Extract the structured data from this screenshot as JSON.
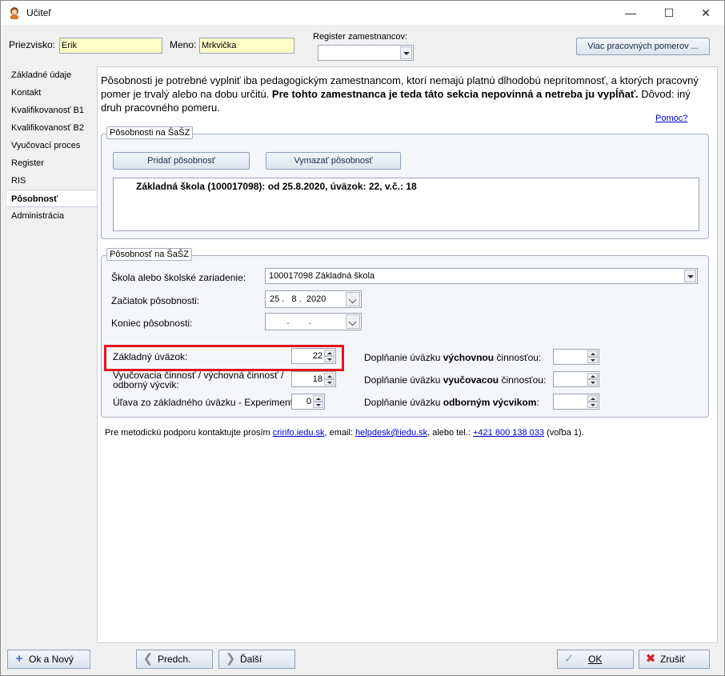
{
  "window": {
    "title": "Učiteľ"
  },
  "header": {
    "surname_label": "Priezvisko:",
    "surname_value": "Erik",
    "name_label": "Meno:",
    "name_value": "Mrkvička",
    "register_label": "Register zamestnancov:",
    "register_value": "",
    "more_employment_button": "Viac pracovných pomerov ..."
  },
  "sidebar": {
    "items": [
      {
        "label": "Základné údaje"
      },
      {
        "label": "Kontakt"
      },
      {
        "label": "Kvalifikovanosť B1"
      },
      {
        "label": "Kvalifikovanosť B2"
      },
      {
        "label": "Vyučovací proces"
      },
      {
        "label": "Register"
      },
      {
        "label": "RIS"
      },
      {
        "label": "Pôsobnosť"
      },
      {
        "label": "Administrácia"
      }
    ],
    "active_index": 7
  },
  "main": {
    "info_normal": "Pôsobnosti je potrebné vyplniť iba pedagogickým zamestnancom, ktorí nemajú platnú dlhodobú neprítomnosť, a ktorých pracovný pomer je trvalý alebo na dobu určitú. ",
    "info_bold": "Pre tohto zamestnanca je teda táto sekcia nepovinná a netreba ju vypĺňať.",
    "info_tail": " Dôvod: iný druh pracovného pomeru.",
    "help_link": "Pomoc?",
    "group1": {
      "title": "Pôsobnosti na ŠaŠZ",
      "add_button": "Pridať pôsobnosť",
      "delete_button": "Vymazať pôsobnosť",
      "list_items": [
        "Základná škola (100017098): od 25.8.2020, úväzok: 22, v.č.: 18"
      ]
    },
    "group2": {
      "title": "Pôsobnosť na ŠaŠZ",
      "school_label": "Škola alebo školské zariadenie:",
      "school_value": "100017098 Základná škola",
      "start_label": "Začiatok pôsobnosti:",
      "start_value": "25 .   8 .  2020",
      "end_label": "Koniec pôsobnosti:",
      "end_value": "       .        .",
      "base_label": "Základný úväzok:",
      "base_value": "22",
      "teaching_label": "Vyučovacia činnosť / výchovná činnosť / odborný výcvik:",
      "teaching_value": "18",
      "relief_label": "Úľava zo základného úväzku - Experiment:",
      "relief_value": "0",
      "fill_edu_prefix": "Doplňanie úväzku ",
      "fill_edu_bold": "výchovnou",
      "fill_edu_suffix": " činnosťou:",
      "fill_edu_value": "",
      "fill_teach_prefix": "Doplňanie úväzku ",
      "fill_teach_bold": "vyučovacou",
      "fill_teach_suffix": " činnosťou:",
      "fill_teach_value": "",
      "fill_train_prefix": "Doplňanie úväzku ",
      "fill_train_bold": "odborným výcvikom",
      "fill_train_suffix": ":",
      "fill_train_value": ""
    },
    "support": {
      "prefix": "Pre metodickú podporu kontaktujte prosím ",
      "link1": "crinfo.iedu.sk",
      "mid1": ", email: ",
      "link2": "helpdesk@iedu.sk",
      "mid2": ", alebo tel.: ",
      "link3": "+421 800 138 033",
      "suffix": " (voľba 1)."
    }
  },
  "footer": {
    "ok_new": "Ok a Nový",
    "prev": "Predch.",
    "next": "Ďalší",
    "ok": "OK",
    "cancel": "Zrušiť"
  },
  "colors": {
    "highlight": "#e0141e",
    "input_yellow": "#ffffc8",
    "link": "#0000cc"
  }
}
